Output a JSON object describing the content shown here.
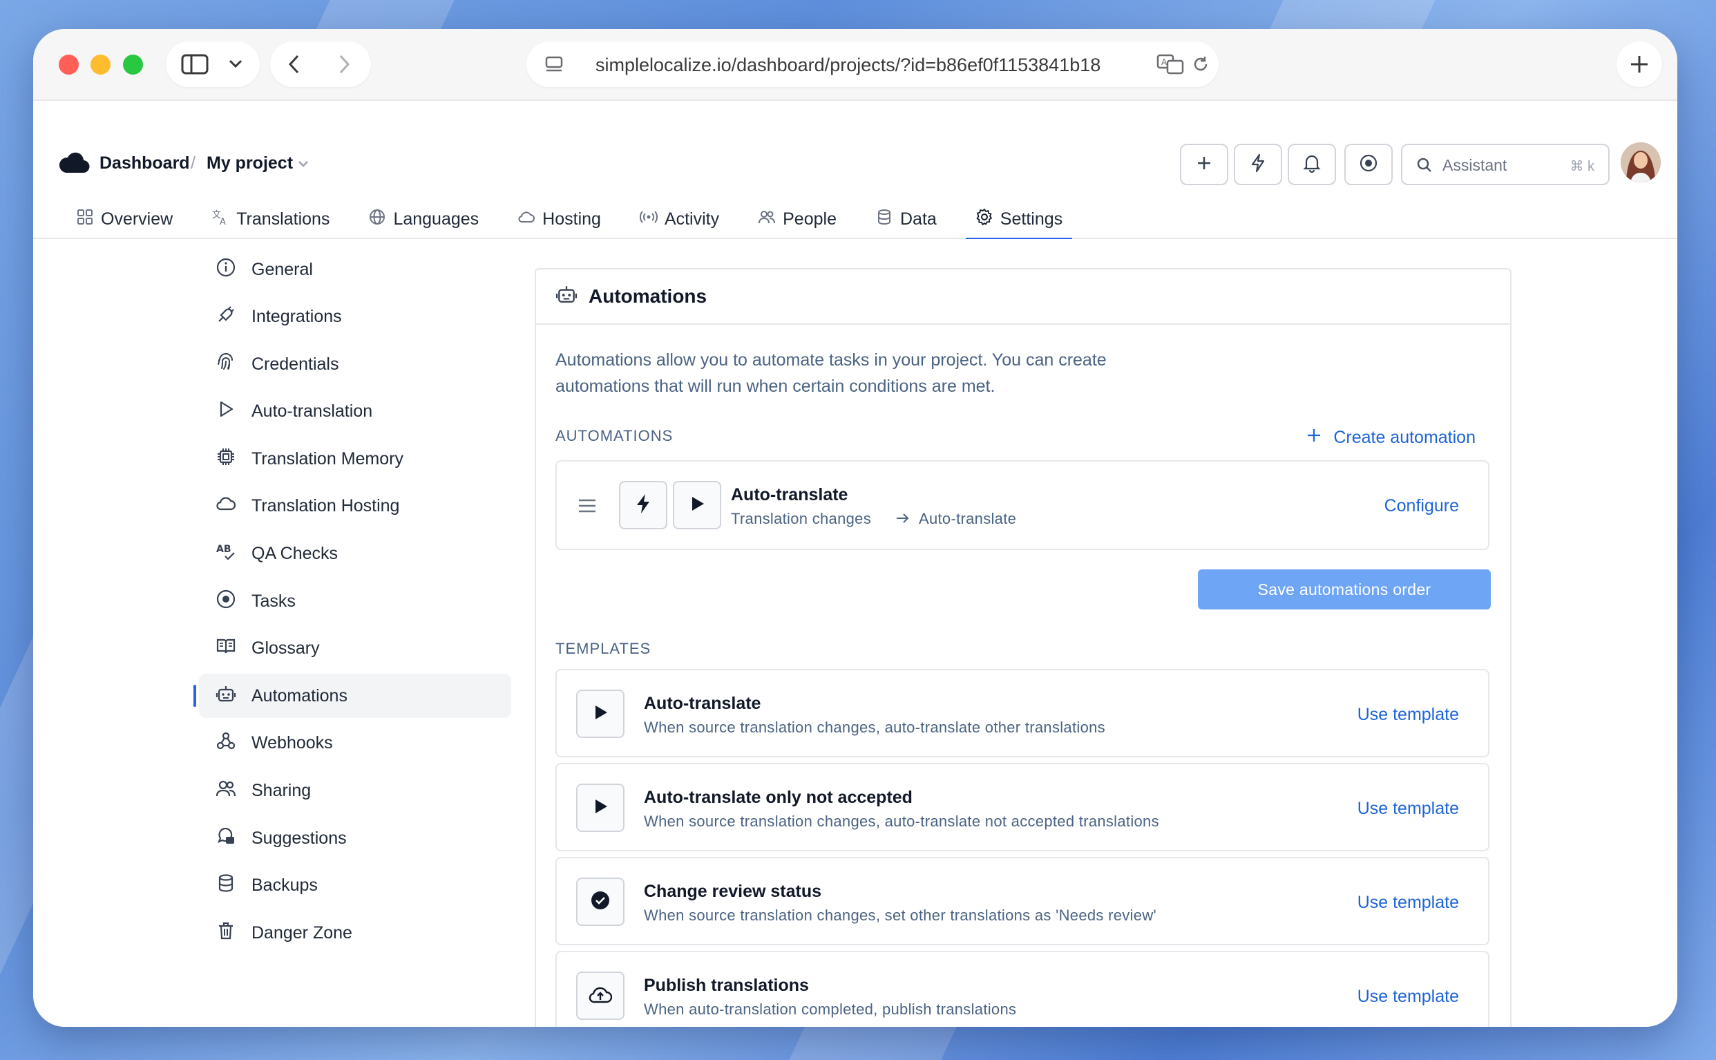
{
  "browser": {
    "url": "simplelocalize.io/dashboard/projects/?id=b86ef0f1153841b18"
  },
  "header": {
    "breadcrumb_root": "Dashboard",
    "breadcrumb_separator": "/",
    "project_name": "My project",
    "assistant_placeholder": "Assistant",
    "assistant_shortcut": "⌘ k"
  },
  "tabs": [
    {
      "label": "Overview",
      "icon": "grid-icon"
    },
    {
      "label": "Translations",
      "icon": "translate-icon"
    },
    {
      "label": "Languages",
      "icon": "globe-icon"
    },
    {
      "label": "Hosting",
      "icon": "cloud-icon"
    },
    {
      "label": "Activity",
      "icon": "broadcast-icon"
    },
    {
      "label": "People",
      "icon": "users-icon"
    },
    {
      "label": "Data",
      "icon": "database-icon"
    },
    {
      "label": "Settings",
      "icon": "gear-icon",
      "active": true
    }
  ],
  "sidebar": {
    "items": [
      {
        "label": "General",
        "icon": "info-icon"
      },
      {
        "label": "Integrations",
        "icon": "plug-icon"
      },
      {
        "label": "Credentials",
        "icon": "fingerprint-icon"
      },
      {
        "label": "Auto-translation",
        "icon": "play-icon"
      },
      {
        "label": "Translation Memory",
        "icon": "chip-icon"
      },
      {
        "label": "Translation Hosting",
        "icon": "cloud-icon"
      },
      {
        "label": "QA Checks",
        "icon": "spellcheck-icon"
      },
      {
        "label": "Tasks",
        "icon": "target-icon"
      },
      {
        "label": "Glossary",
        "icon": "book-icon"
      },
      {
        "label": "Automations",
        "icon": "robot-icon",
        "active": true
      },
      {
        "label": "Webhooks",
        "icon": "webhook-icon"
      },
      {
        "label": "Sharing",
        "icon": "users-icon"
      },
      {
        "label": "Suggestions",
        "icon": "chat-icon"
      },
      {
        "label": "Backups",
        "icon": "database-icon"
      },
      {
        "label": "Danger Zone",
        "icon": "trash-icon"
      }
    ]
  },
  "panel": {
    "title": "Automations",
    "description": "Automations allow you to automate tasks in your project. You can create automations that will run when certain conditions are met.",
    "automations_label": "AUTOMATIONS",
    "create_label": "Create automation",
    "automation": {
      "title": "Auto-translate",
      "trigger": "Translation changes",
      "action": "Auto-translate",
      "link": "Configure"
    },
    "save_label": "Save automations order",
    "templates_label": "TEMPLATES",
    "templates": [
      {
        "title": "Auto-translate",
        "desc": "When source translation changes, auto-translate other translations",
        "link": "Use template",
        "icon": "play-icon"
      },
      {
        "title": "Auto-translate only not accepted",
        "desc": "When source translation changes, auto-translate not accepted translations",
        "link": "Use template",
        "icon": "play-icon"
      },
      {
        "title": "Change review status",
        "desc": "When source translation changes, set other translations as 'Needs review'",
        "link": "Use template",
        "icon": "check-circle-icon"
      },
      {
        "title": "Publish translations",
        "desc": "When auto-translation completed, publish translations",
        "link": "Use template",
        "icon": "cloud-upload-icon"
      }
    ]
  },
  "colors": {
    "accent": "#2563eb",
    "link": "#1d64d8",
    "button": "#6ea5f5",
    "muted_text": "#4b6383"
  }
}
